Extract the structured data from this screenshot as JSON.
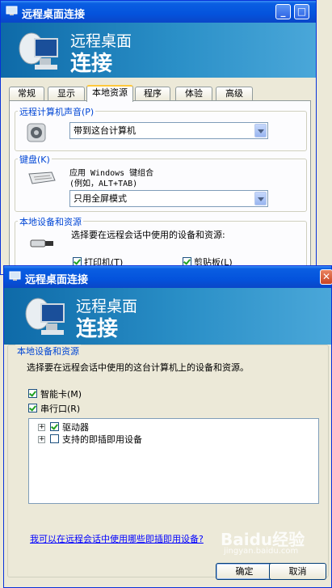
{
  "window_back": {
    "title": "远程桌面连接",
    "banner": {
      "line1": "远程桌面",
      "line2": "连接"
    },
    "tabs": [
      "常规",
      "显示",
      "本地资源",
      "程序",
      "体验",
      "高级"
    ],
    "active_tab": "本地资源",
    "sound": {
      "group_title": "远程计算机声音(P)",
      "combo_value": "带到这台计算机"
    },
    "keyboard": {
      "group_title": "键盘(K)",
      "desc_line1": "应用 Windows 键组合",
      "desc_line2": "(例如，ALT+TAB)",
      "combo_value": "只用全屏模式"
    },
    "devices": {
      "group_title": "本地设备和资源",
      "desc": "选择要在远程会话中使用的设备和资源:",
      "checkbox1": "打印机(T)",
      "checkbox2": "剪贴板(L)"
    }
  },
  "window_front": {
    "title": "远程桌面连接",
    "banner": {
      "line1": "远程桌面",
      "line2": "连接"
    },
    "group_title": "本地设备和资源",
    "desc": "选择要在远程会话中使用的这台计算机上的设备和资源。",
    "smartcard": "智能卡(M)",
    "serial": "串行口(R)",
    "tree": [
      {
        "label": "驱动器",
        "checked": true
      },
      {
        "label": "支持的即插即用设备",
        "checked": false
      }
    ],
    "link": "我可以在远程会话中使用哪些即插即用设备?",
    "ok": "确定",
    "cancel": "取消"
  },
  "watermark": {
    "logo": "Baidu经验",
    "url": "jingyan.baidu.com"
  }
}
